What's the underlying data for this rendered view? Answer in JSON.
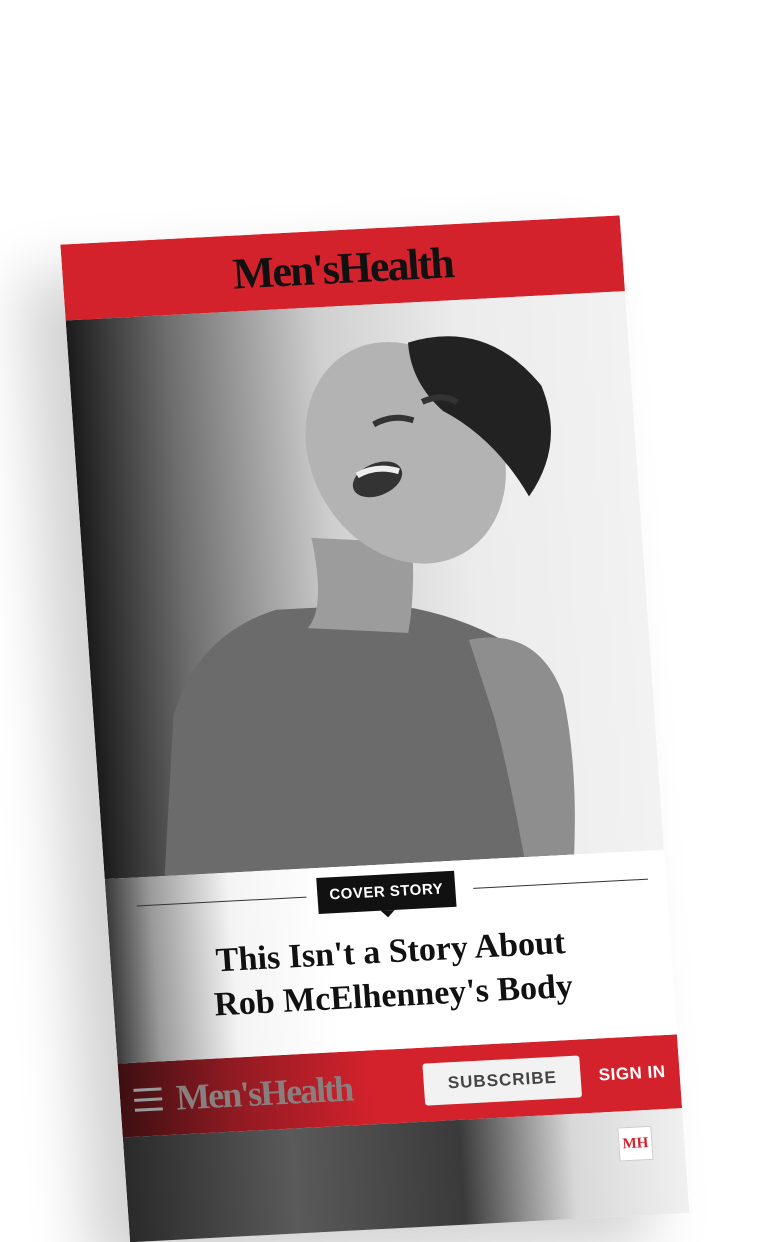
{
  "header": {
    "logo_text": "Men'sHealth"
  },
  "hero": {
    "image_icon": "portrait-photo"
  },
  "article": {
    "badge": "COVER STORY",
    "headline_line1": "This Isn't a Story About",
    "headline_line2": "Rob McElhenney's Body"
  },
  "navbar": {
    "menu_icon": "hamburger-menu-icon",
    "logo_text": "Men'sHealth",
    "subscribe_label": "SUBSCRIBE",
    "signin_label": "SIGN IN"
  },
  "below": {
    "badge_text": "MH"
  },
  "colors": {
    "brand_red": "#d3222c",
    "ink": "#111111"
  }
}
